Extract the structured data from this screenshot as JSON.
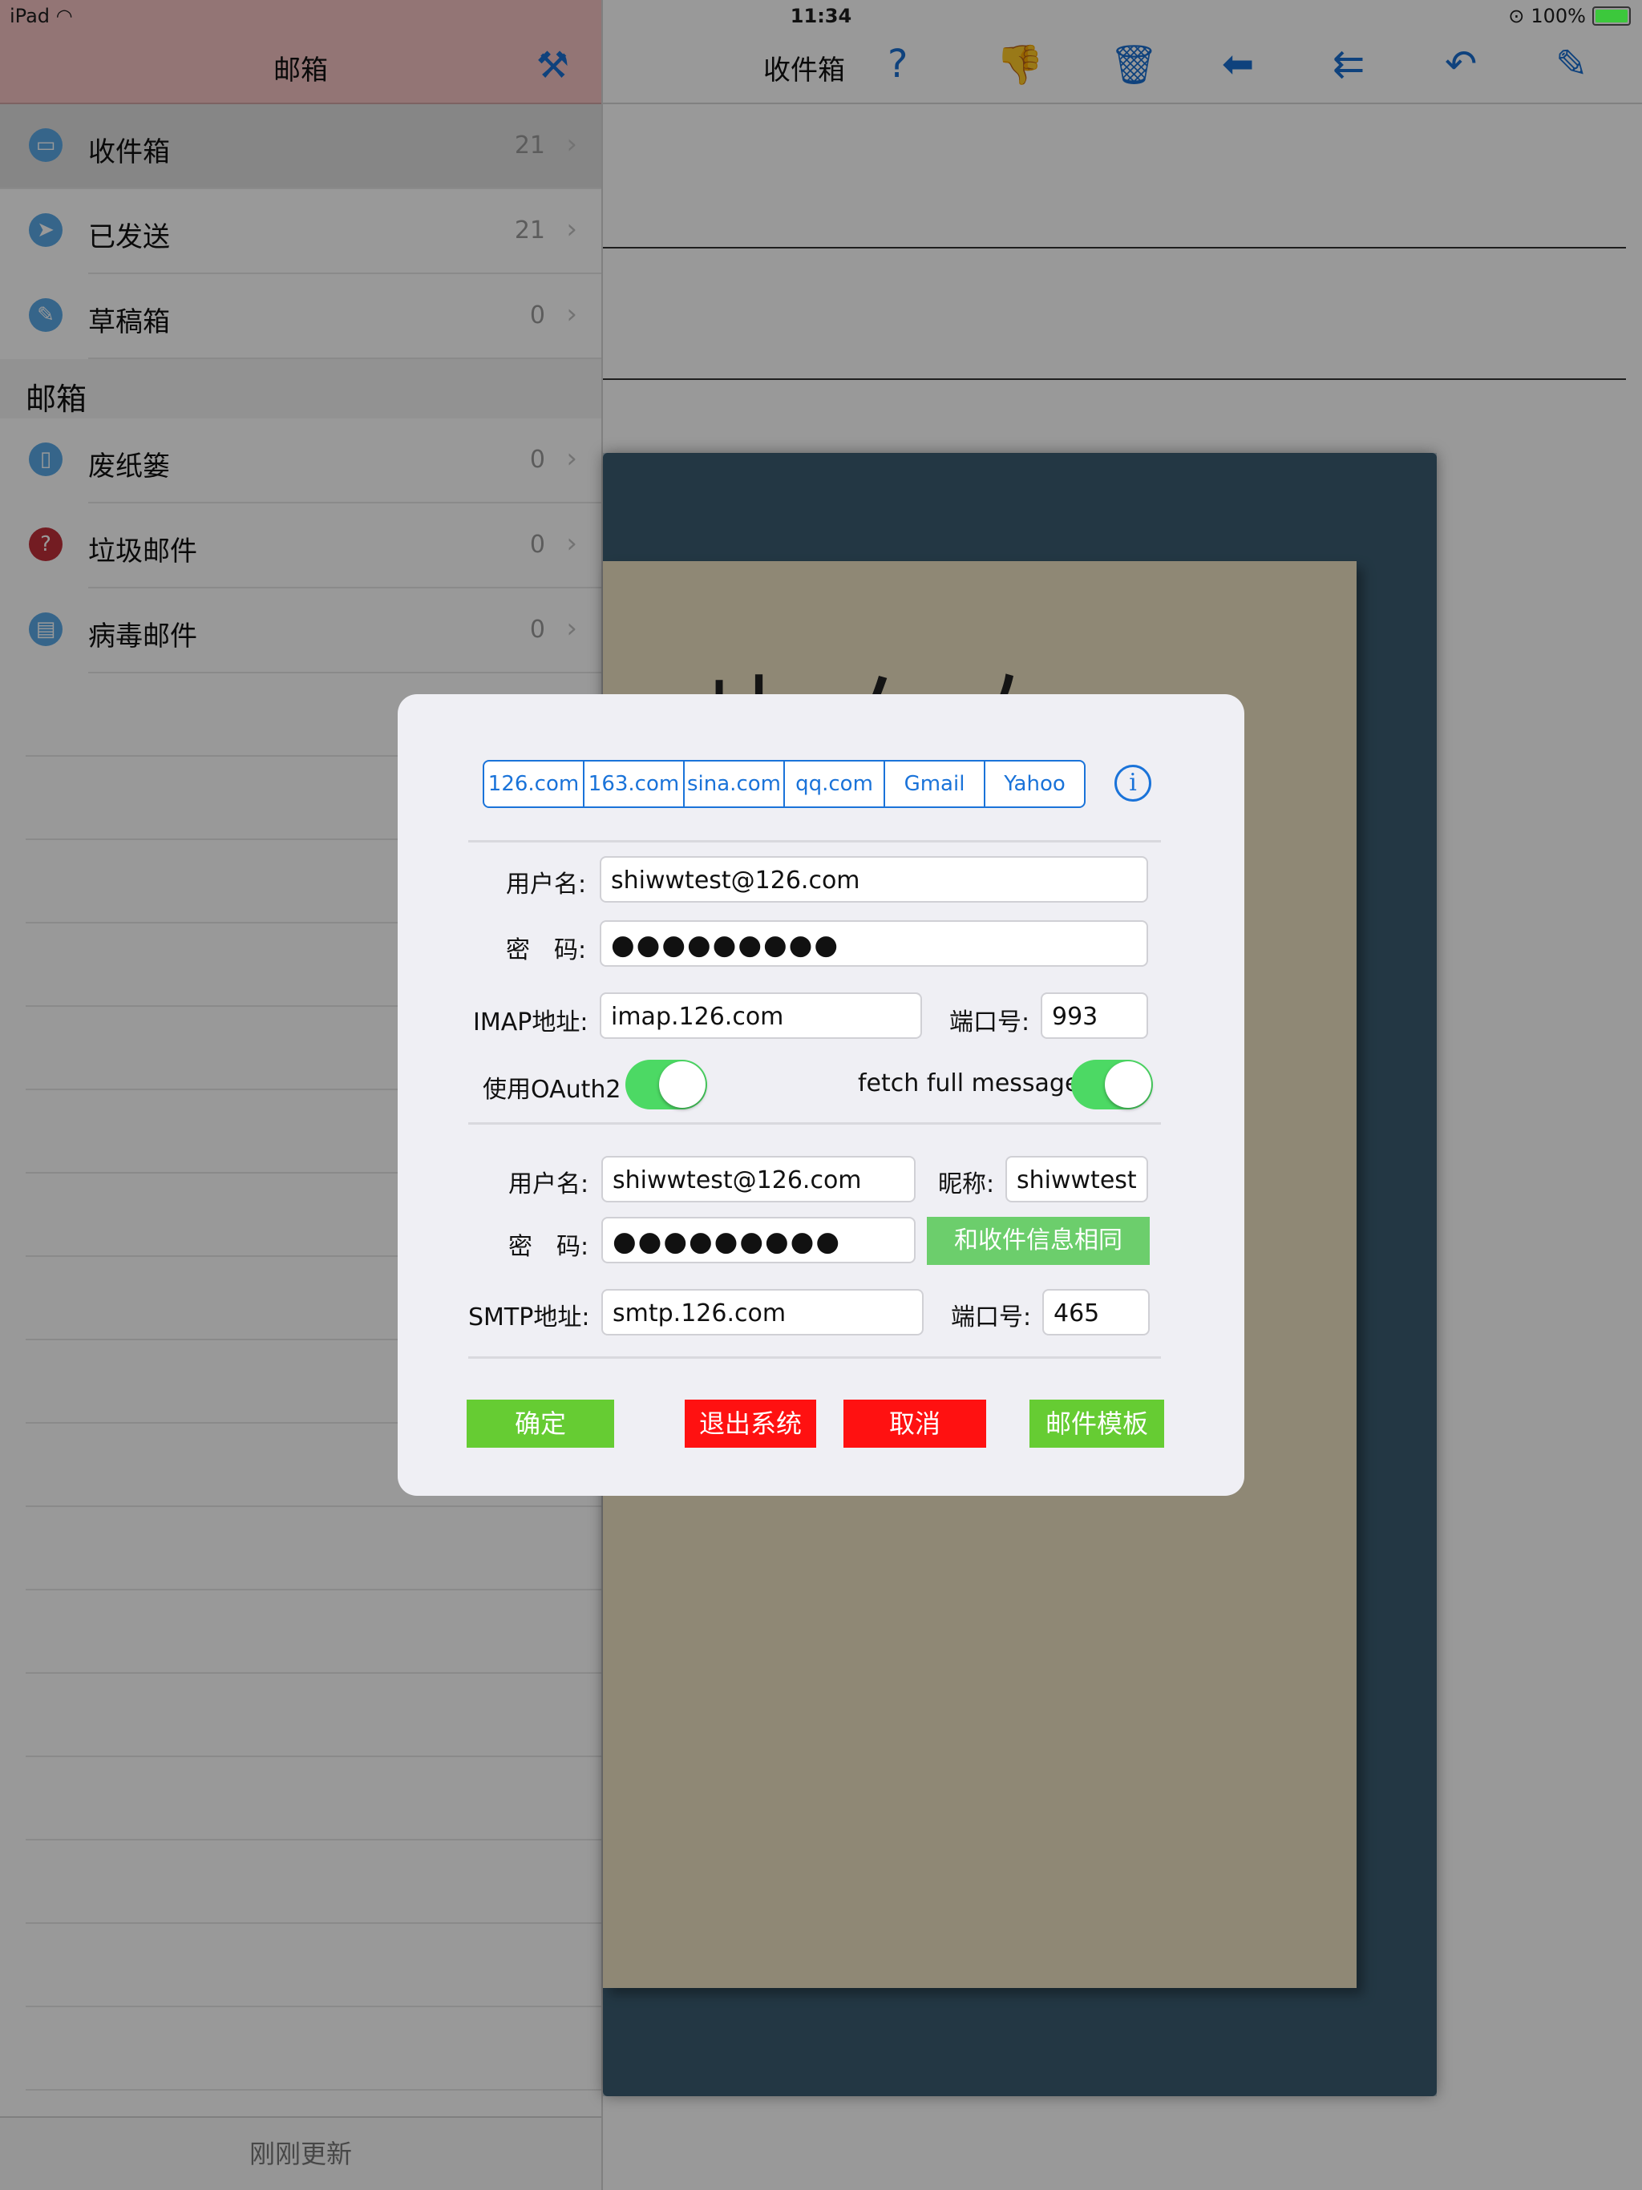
{
  "status_bar": {
    "device": "iPad",
    "time": "11:34",
    "battery": "100%"
  },
  "sidebar": {
    "title": "邮箱",
    "items": [
      {
        "label": "收件箱",
        "count": "21",
        "icon": "inbox-icon"
      },
      {
        "label": "已发送",
        "count": "21",
        "icon": "paper-plane-icon"
      },
      {
        "label": "草稿箱",
        "count": "0",
        "icon": "pencil-icon"
      }
    ],
    "section_title": "邮箱",
    "items2": [
      {
        "label": "废纸篓",
        "count": "0",
        "icon": "trash-icon"
      },
      {
        "label": "垃圾邮件",
        "count": "0",
        "icon": "question-icon"
      },
      {
        "label": "病毒邮件",
        "count": "0",
        "icon": "clipboard-icon"
      }
    ],
    "footer": "刚刚更新"
  },
  "toolbar": {
    "title": "收件箱"
  },
  "dialog": {
    "providers": [
      "126.com",
      "163.com",
      "sina.com",
      "qq.com",
      "Gmail",
      "Yahoo"
    ],
    "imap": {
      "username_label": "用户名:",
      "username": "shiwwtest@126.com",
      "password_label": "密　码:",
      "password": "●●●●●●●●●",
      "server_label": "IMAP地址:",
      "server": "imap.126.com",
      "port_label": "端口号:",
      "port": "993",
      "oauth_label": "使用OAuth2",
      "fetch_label": "fetch full message"
    },
    "smtp": {
      "username_label": "用户名:",
      "username": "shiwwtest@126.com",
      "nickname_label": "昵称:",
      "nickname": "shiwwtest",
      "password_label": "密　码:",
      "password": "●●●●●●●●●",
      "same_button": "和收件信息相同",
      "server_label": "SMTP地址:",
      "server": "smtp.126.com",
      "port_label": "端口号:",
      "port": "465"
    },
    "buttons": {
      "ok": "确定",
      "logout": "退出系统",
      "cancel": "取消",
      "template": "邮件模板"
    }
  },
  "colors": {
    "accent": "#1a73d9",
    "green": "#66cc33",
    "red": "#ff1111",
    "toggle_on": "#4cd964"
  }
}
